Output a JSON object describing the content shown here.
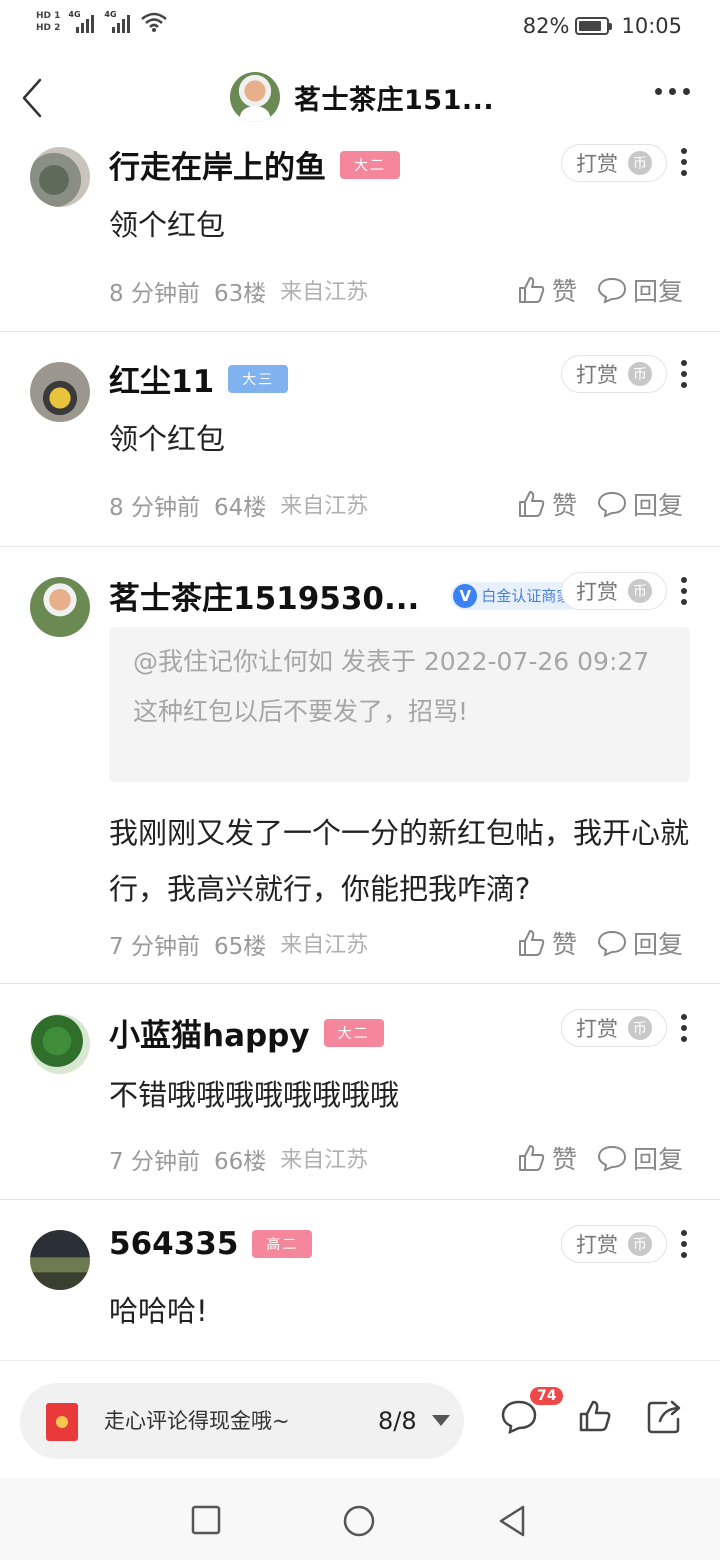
{
  "status_bar": {
    "hd1": "HD 1",
    "hd2": "HD 2",
    "net1": "4G",
    "net2": "4G",
    "battery_text": "82%",
    "battery_level": 0.82,
    "time": "10:05"
  },
  "header": {
    "title": "茗士茶庄151...",
    "back_icon": "chevron-left-icon",
    "more_icon": "more-horizontal-icon"
  },
  "comments": [
    {
      "username": "行走在岸上的鱼",
      "badge": "大二",
      "badge_color": "#f4879b",
      "tip_label": "打赏",
      "coin": "币",
      "content": "领个红包",
      "time": "8 分钟前",
      "floor": "63楼",
      "location": "来自江苏",
      "like_label": "赞",
      "reply_label": "回复"
    },
    {
      "username": "红尘11",
      "badge": "大三",
      "badge_color": "#7fb2ef",
      "tip_label": "打赏",
      "coin": "币",
      "content": "领个红包",
      "time": "8 分钟前",
      "floor": "64楼",
      "location": "来自江苏",
      "like_label": "赞",
      "reply_label": "回复"
    },
    {
      "username": "茗士茶庄1519530...",
      "merchant_v": "V",
      "merchant_label": "白金认证商家",
      "tip_label": "打赏",
      "coin": "币",
      "quote_header": "@我住记你让何如 发表于 2022-07-26 09:27",
      "quote_body": "这种红包以后不要发了，招骂!",
      "content": "我刚刚又发了一个一分的新红包帖，我开心就行，我高兴就行，你能把我咋滴?",
      "time": "7 分钟前",
      "floor": "65楼",
      "location": "来自江苏",
      "like_label": "赞",
      "reply_label": "回复"
    },
    {
      "username": "小蓝猫happy",
      "badge": "大二",
      "badge_color": "#f4879b",
      "tip_label": "打赏",
      "coin": "币",
      "content": "不错哦哦哦哦哦哦哦哦",
      "time": "7 分钟前",
      "floor": "66楼",
      "location": "来自江苏",
      "like_label": "赞",
      "reply_label": "回复"
    },
    {
      "username": "564335",
      "badge": "高二",
      "badge_color": "#f4879b",
      "tip_label": "打赏",
      "coin": "币",
      "content": "哈哈哈!"
    }
  ],
  "bottom_bar": {
    "input_text": "走心评论得现金哦~",
    "page_indicator": "8/8",
    "comment_count": "74",
    "icons": [
      "red-packet-icon",
      "comment-icon",
      "thumb-up-icon",
      "share-icon"
    ]
  },
  "nav_bar": {
    "icons": [
      "recent-apps-icon",
      "home-icon",
      "back-icon"
    ]
  }
}
